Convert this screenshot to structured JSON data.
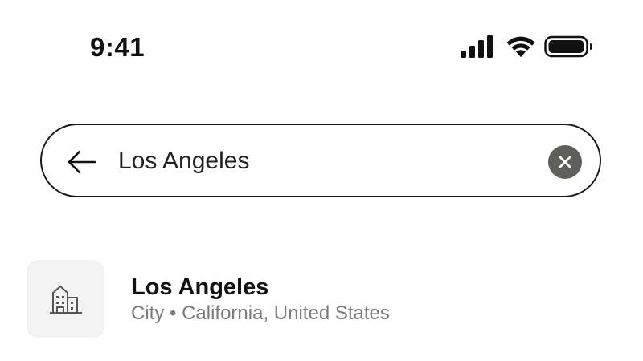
{
  "status_bar": {
    "time": "9:41",
    "icons": [
      "signal-icon",
      "wifi-icon",
      "battery-icon"
    ]
  },
  "search": {
    "value": "Los Angeles",
    "back_icon": "arrow-left-icon",
    "clear_icon": "close-icon"
  },
  "results": [
    {
      "icon": "building-icon",
      "title": "Los Angeles",
      "subtitle": "City • California, United States"
    }
  ],
  "colors": {
    "clear_button_bg": "#5f605c",
    "thumb_bg": "#f3f3f3",
    "subtitle_text": "#7a7a7a"
  }
}
